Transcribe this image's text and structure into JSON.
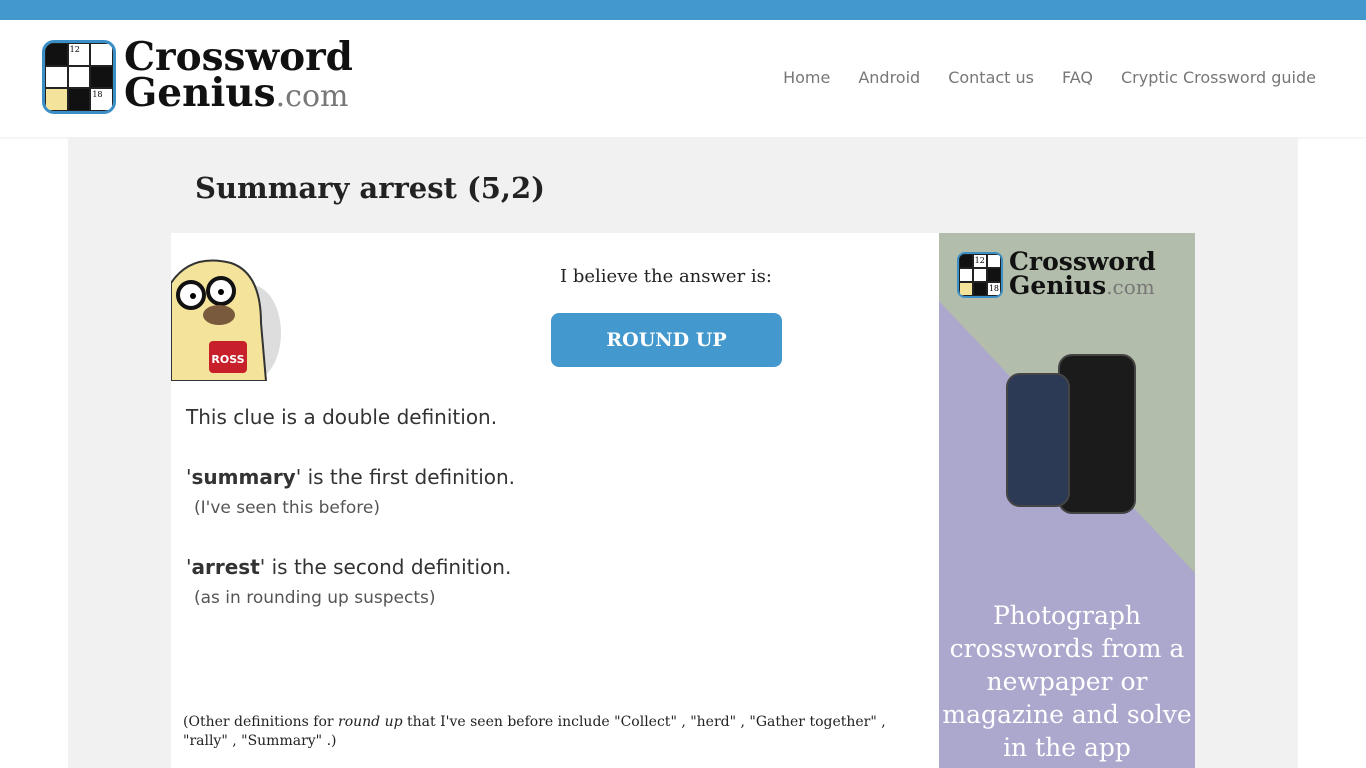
{
  "header": {
    "logo_text_1": "Crossword",
    "logo_text_2": "Genius",
    "logo_text_3": ".com",
    "logo_num_1": "12",
    "logo_num_2": "18",
    "nav": [
      "Home",
      "Android",
      "Contact us",
      "FAQ",
      "Cryptic Crossword guide"
    ]
  },
  "page": {
    "title": "Summary arrest (5,2)",
    "believe": "I believe the answer is:",
    "answer": "ROUND UP",
    "mascot_mug_text": "ROSS",
    "explanation": "This clue is a double definition.",
    "def1_quote_open": "'",
    "def1_word": "summary",
    "def1_rest": "' is the first definition.",
    "def1_note": "(I've seen this before)",
    "def2_quote_open": "'",
    "def2_word": "arrest",
    "def2_rest": "' is the second definition.",
    "def2_note": "(as in rounding up suspects)",
    "other_prefix": "(Other definitions for ",
    "other_term": "round up",
    "other_suffix": " that I've seen before include \"Collect\" , \"herd\" , \"Gather together\" , \"rally\" , \"Summary\" .)"
  },
  "ad": {
    "text": "Photograph crosswords from a newpaper or magazine and solve in the app"
  },
  "colors": {
    "accent": "#4399cd",
    "ad_purple": "#aca7cd",
    "ad_green": "#b3bdab"
  }
}
